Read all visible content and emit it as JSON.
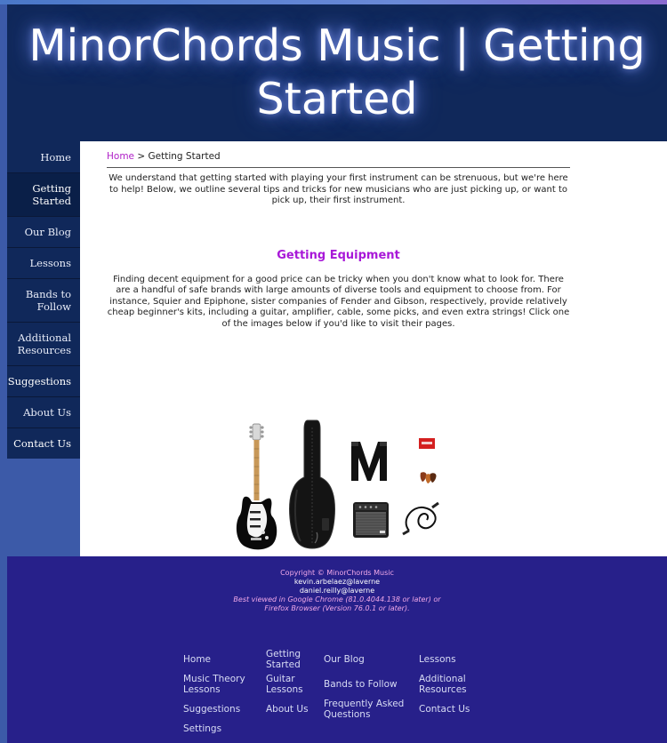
{
  "site": {
    "title": "MinorChords Music | Getting Started"
  },
  "nav": {
    "items": [
      {
        "label": "Home"
      },
      {
        "label": "Getting Started"
      },
      {
        "label": "Our Blog"
      },
      {
        "label": "Lessons"
      },
      {
        "label": "Bands to Follow"
      },
      {
        "label": "Additional Resources"
      },
      {
        "label": "Suggestions"
      },
      {
        "label": "About Us"
      },
      {
        "label": "Contact Us"
      }
    ]
  },
  "breadcrumb": {
    "home": "Home",
    "separator": ">",
    "current": "Getting Started"
  },
  "content": {
    "intro": "We understand that getting started with playing your first instrument can be strenuous, but we're here to help! Below, we outline several tips and tricks for new musicians who are just picking up, or want to pick up, their first instrument.",
    "section_heading": "Getting Equipment",
    "section_body": "Finding decent equipment for a good price can be tricky when you don't know what to look for. There are a handful of safe brands with large amounts of diverse tools and equipment to choose from. For instance, Squier and Epiphone, sister companies of Fender and Gibson, respectively, provide relatively cheap beginner's kits, including a guitar, amplifier, cable, some picks, and even extra strings! Click one of the images below if you'd like to visit their pages."
  },
  "products": {
    "icons": [
      "electric-guitar-icon",
      "gig-bag-icon",
      "guitar-strap-icon",
      "string-pack-icon",
      "guitar-picks-icon",
      "amplifier-icon",
      "instrument-cable-icon"
    ],
    "colors": {
      "guitar_body": "#0a0a0a",
      "pickguard": "#f4f4f4",
      "neck": "#c89858",
      "strings_pack": "#d42020"
    }
  },
  "footer": {
    "copyright": "Copyright © MinorChords Music",
    "email1": "kevin.arbelaez@laverne",
    "email2": "daniel.reilly@laverne",
    "browser_note_1": "Best viewed in Google Chrome (81.0.4044.138 or later) or",
    "browser_note_2": "Firefox Browser (Version 76.0.1 or later).",
    "links": [
      {
        "label": "Home"
      },
      {
        "label": "Getting Started"
      },
      {
        "label": "Our Blog"
      },
      {
        "label": "Lessons"
      },
      {
        "label": "Music Theory Lessons"
      },
      {
        "label": "Guitar Lessons"
      },
      {
        "label": "Bands to Follow"
      },
      {
        "label": "Additional Resources"
      },
      {
        "label": "Suggestions"
      },
      {
        "label": "About Us"
      },
      {
        "label": "Frequently Asked Questions"
      },
      {
        "label": "Contact Us"
      },
      {
        "label": "Settings"
      }
    ]
  },
  "colors": {
    "header_bg": "#10285a",
    "footer_bg": "#27208a",
    "accent_purple": "#a818d8",
    "link_pink": "#b020c8",
    "page_bg": "#3c5aa8"
  }
}
